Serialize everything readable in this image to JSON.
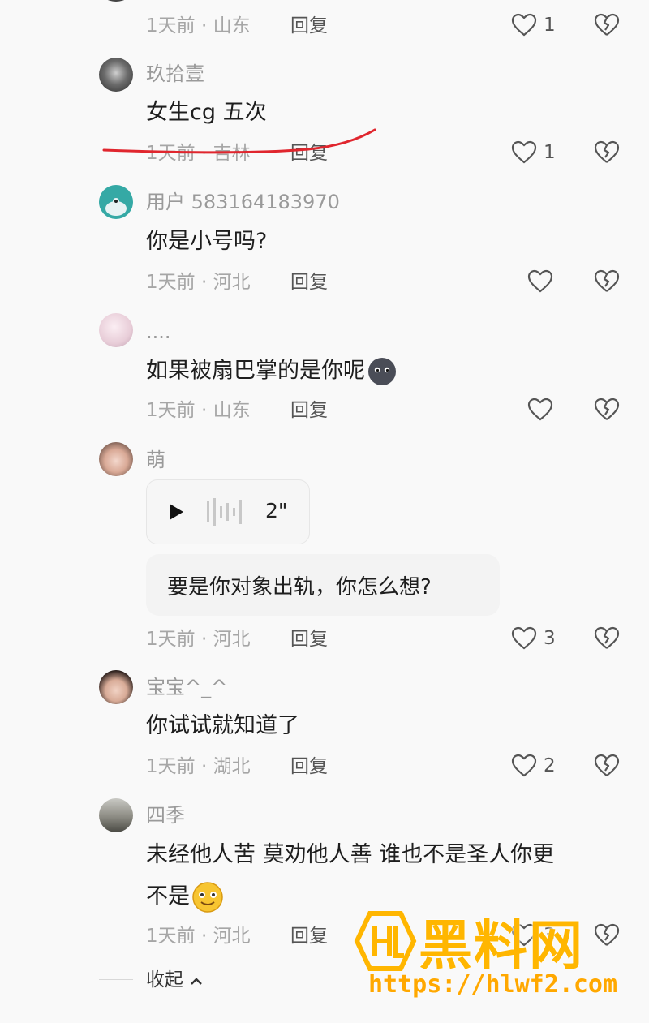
{
  "top_fragment": {
    "meta": "1天前 · 山东",
    "reply": "回复",
    "likes": "1"
  },
  "comments": [
    {
      "name": "玖拾壹",
      "text": "女生cg 五次",
      "meta": "1天前 · 吉林",
      "reply": "回复",
      "likes": "1"
    },
    {
      "name": "用户 583164183970",
      "text": "你是小号吗?",
      "meta": "1天前 · 河北",
      "reply": "回复",
      "likes": ""
    },
    {
      "name": "....",
      "text": "如果被扇巴掌的是你呢",
      "meta": "1天前 · 山东",
      "reply": "回复",
      "likes": ""
    },
    {
      "name": "萌",
      "voice_duration": "2\"",
      "voice_transcript": "要是你对象出轨，你怎么想?",
      "meta": "1天前 · 河北",
      "reply": "回复",
      "likes": "3"
    },
    {
      "name": "宝宝^_^",
      "text": "你试试就知道了",
      "meta": "1天前 · 湖北",
      "reply": "回复",
      "likes": "2"
    },
    {
      "name": "四季",
      "text_line1": "未经他人苦  莫劝他人善 谁也不是圣人你更",
      "text_line2": "不是",
      "meta": "1天前 · 河北",
      "reply": "回复",
      "likes": "3"
    }
  ],
  "collapse_label": "收起",
  "watermark": {
    "title": "黑料网",
    "url": "https://hlwf2.com"
  },
  "colors": {
    "accent_strike": "#e0262e",
    "watermark": "#ffb600"
  }
}
